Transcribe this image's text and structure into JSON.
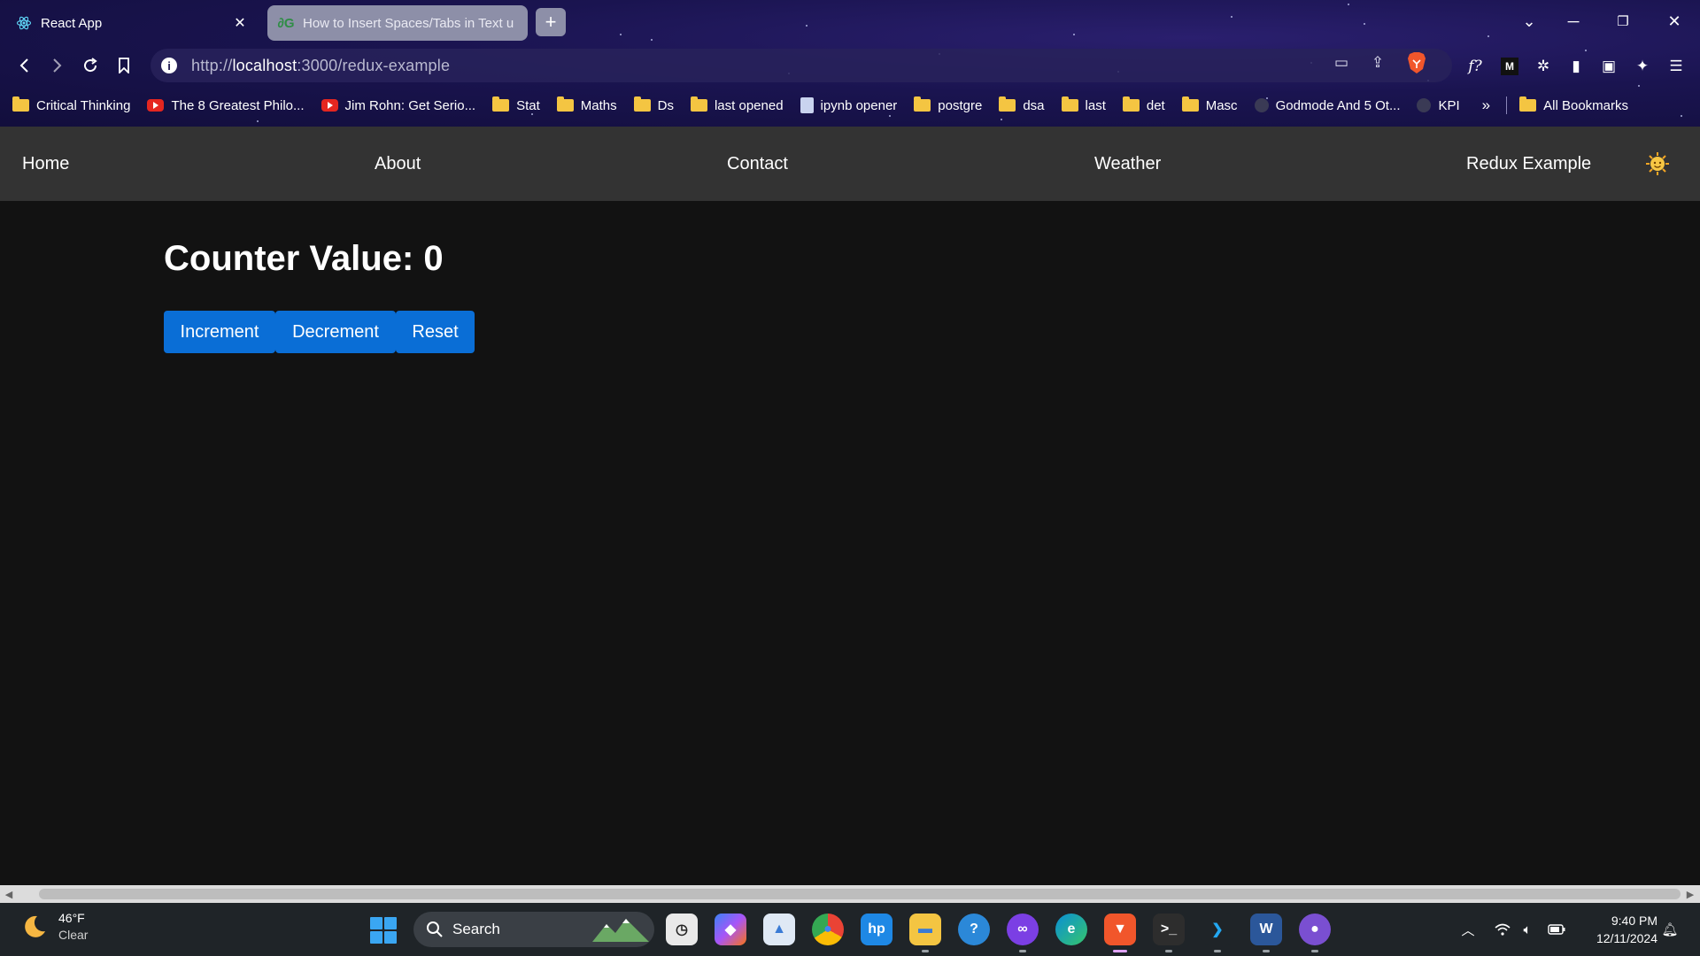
{
  "browser": {
    "tabs": [
      {
        "title": "React App",
        "favicon": "react-icon",
        "active": true
      },
      {
        "title": "How to Insert Spaces/Tabs in Text u",
        "favicon": "gfg-icon",
        "active": false
      }
    ],
    "new_tab_label": "+",
    "url": {
      "scheme": "http://",
      "host": "localhost",
      "rest": ":3000/redux-example"
    },
    "bookmarks": [
      {
        "label": "Critical Thinking",
        "icon": "folder-icon"
      },
      {
        "label": "The 8 Greatest Philo...",
        "icon": "youtube-icon"
      },
      {
        "label": "Jim Rohn: Get Serio...",
        "icon": "youtube-icon"
      },
      {
        "label": "Stat",
        "icon": "folder-icon"
      },
      {
        "label": "Maths",
        "icon": "folder-icon"
      },
      {
        "label": "Ds",
        "icon": "folder-icon"
      },
      {
        "label": "last opened",
        "icon": "folder-icon"
      },
      {
        "label": "ipynb opener",
        "icon": "notebook-icon"
      },
      {
        "label": "postgre",
        "icon": "folder-icon"
      },
      {
        "label": "dsa",
        "icon": "folder-icon"
      },
      {
        "label": "last",
        "icon": "folder-icon"
      },
      {
        "label": "det",
        "icon": "folder-icon"
      },
      {
        "label": "Masc",
        "icon": "folder-icon"
      },
      {
        "label": "Godmode And 5 Ot...",
        "icon": "arm-icon"
      },
      {
        "label": "KPI",
        "icon": "circle-icon"
      }
    ],
    "more_bookmarks": "»",
    "all_bookmarks": "All Bookmarks"
  },
  "app": {
    "nav": [
      "Home",
      "About",
      "Contact",
      "Weather",
      "Redux Example"
    ],
    "counter_label": "Counter Value:",
    "counter_value": 0,
    "counter_heading": "Counter Value: 0",
    "buttons": {
      "increment": "Increment",
      "decrement": "Decrement",
      "reset": "Reset"
    },
    "accent_color": "#0a6ed6",
    "nav_background": "#333333",
    "page_background": "#121212"
  },
  "taskbar": {
    "weather": {
      "temp": "46°F",
      "condition": "Clear"
    },
    "search_label": "Search",
    "apps": [
      "clock-app-icon",
      "copilot-icon",
      "photos-icon",
      "chrome-icon",
      "myhp-icon",
      "file-explorer-icon",
      "feedback-icon",
      "game-icon",
      "edge-icon",
      "brave-icon",
      "terminal-icon",
      "vscode-icon",
      "word-icon",
      "github-icon"
    ],
    "clock": {
      "time": "9:40 PM",
      "date": "12/11/2024"
    }
  }
}
